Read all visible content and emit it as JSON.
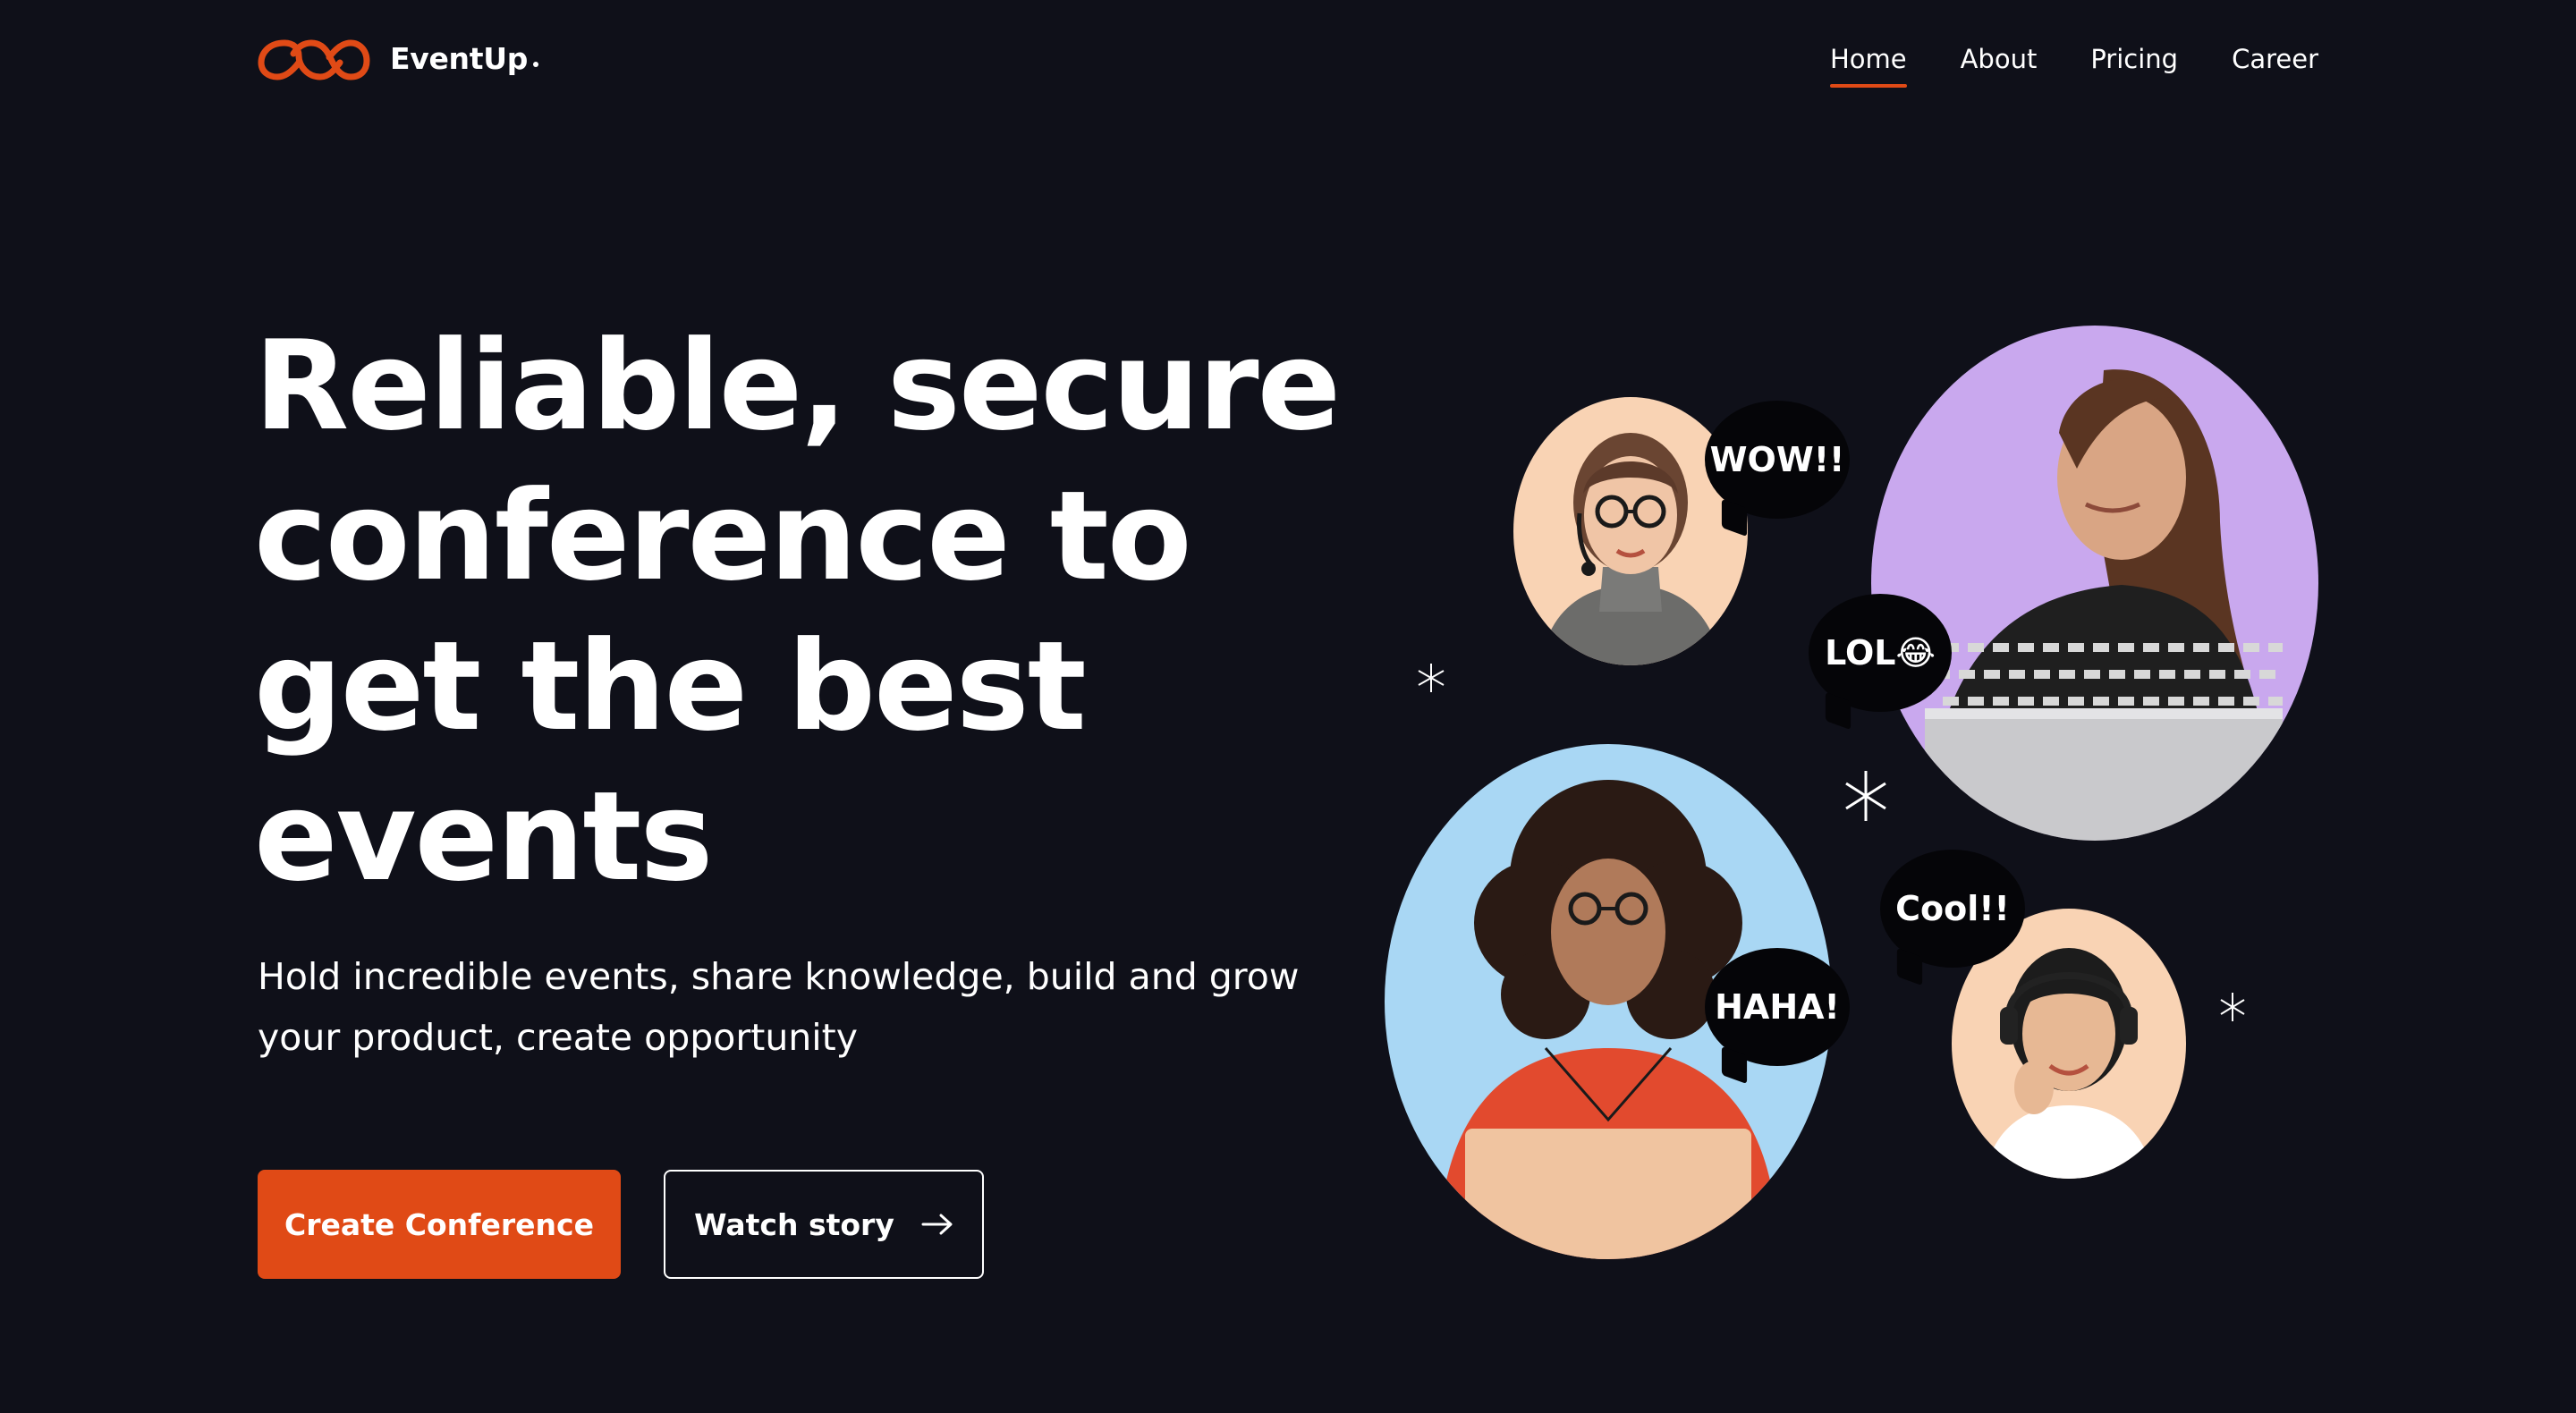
{
  "brand": {
    "name": "EventUp",
    "accent": "#e04a16",
    "background": "#0f1019"
  },
  "nav": {
    "items": [
      {
        "label": "Home",
        "active": true
      },
      {
        "label": "About",
        "active": false
      },
      {
        "label": "Pricing",
        "active": false
      },
      {
        "label": "Career",
        "active": false
      }
    ]
  },
  "hero": {
    "title": "Reliable, secure conference to get the best events",
    "subtitle": "Hold incredible events, share knowledge, build and grow your product, create opportunity",
    "primary_cta": "Create Conference",
    "secondary_cta": "Watch story",
    "secondary_cta_icon": "arrow-right-icon"
  },
  "illustration": {
    "bubbles": [
      "WOW!!",
      "LOL😂",
      "HAHA!",
      "Cool!!"
    ],
    "portrait_backgrounds": {
      "headset_woman": "#f9d3b4",
      "laptop_woman_purple": "#c9a8ee",
      "curly_woman": "#a9d7f4",
      "headset_woman_right": "#f9d3b4"
    }
  }
}
